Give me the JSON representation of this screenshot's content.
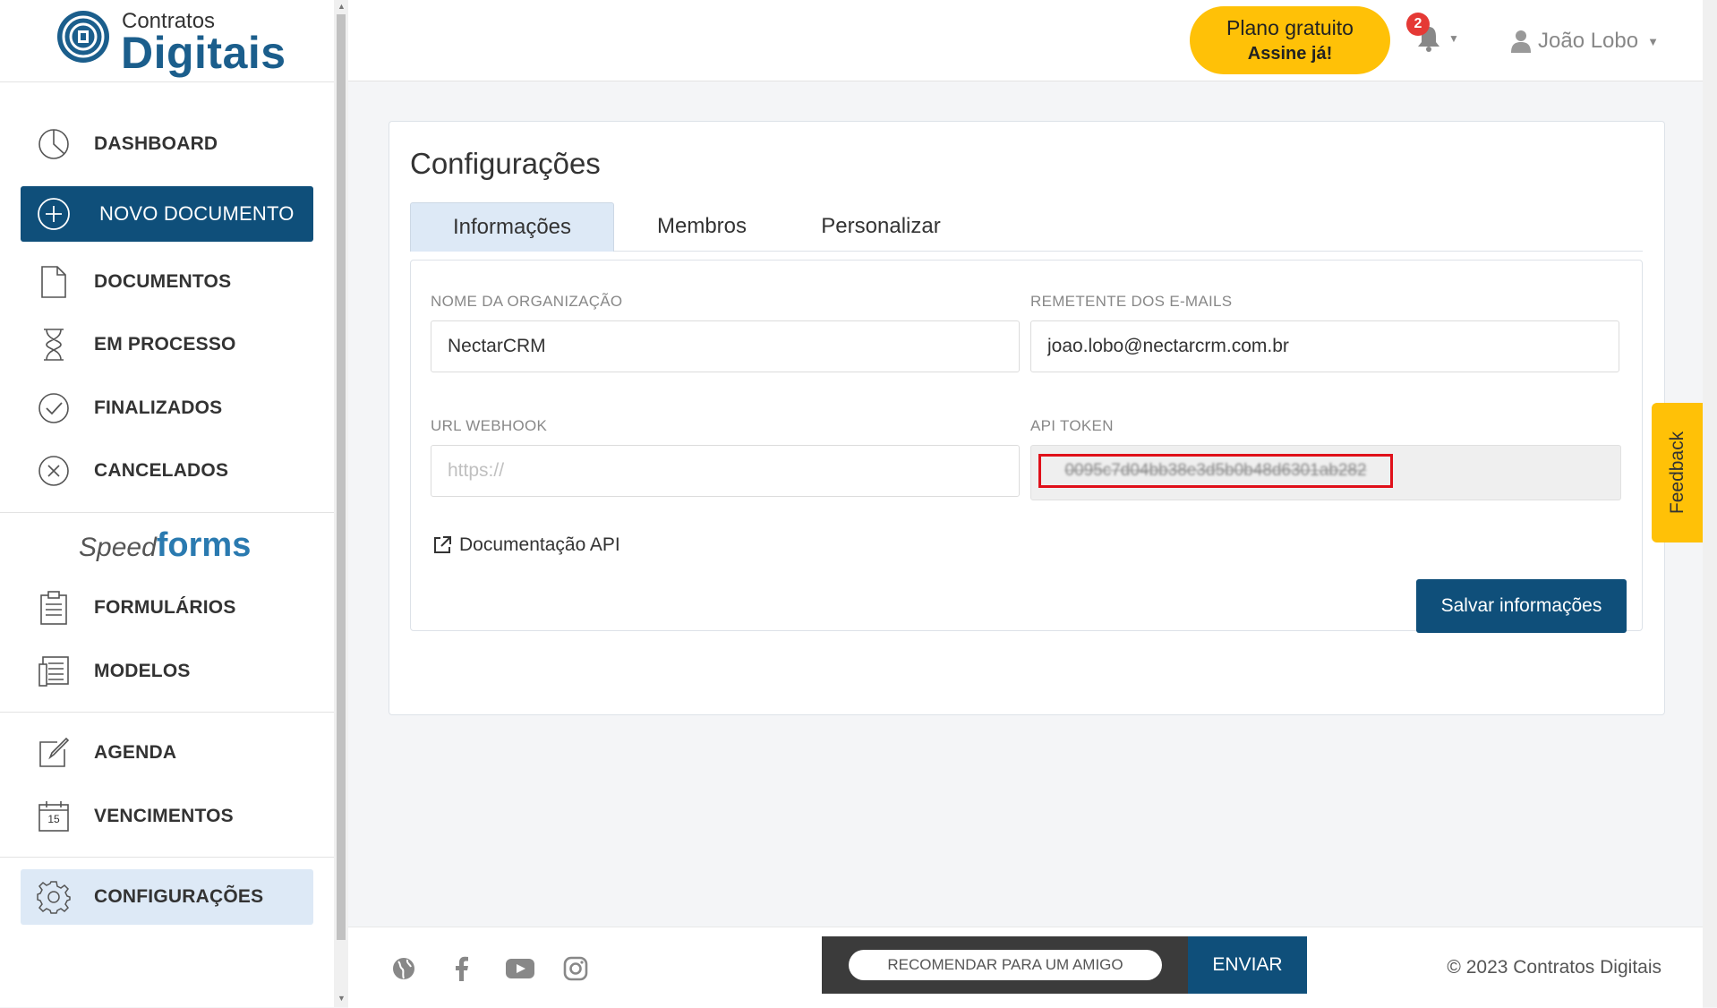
{
  "logo": {
    "small": "Contratos",
    "big": "Digitais"
  },
  "sidebar": {
    "items": [
      {
        "label": "DASHBOARD",
        "icon": "pie-chart-icon"
      },
      {
        "label": "NOVO DOCUMENTO",
        "icon": "plus-circle-icon"
      },
      {
        "label": "DOCUMENTOS",
        "icon": "document-icon"
      },
      {
        "label": "EM PROCESSO",
        "icon": "hourglass-icon"
      },
      {
        "label": "FINALIZADOS",
        "icon": "check-circle-icon"
      },
      {
        "label": "CANCELADOS",
        "icon": "x-circle-icon"
      },
      {
        "label": "FORMULÁRIOS",
        "icon": "clipboard-icon"
      },
      {
        "label": "MODELOS",
        "icon": "templates-icon"
      },
      {
        "label": "AGENDA",
        "icon": "edit-icon"
      },
      {
        "label": "VENCIMENTOS",
        "icon": "calendar-icon"
      },
      {
        "label": "CONFIGURAÇÕES",
        "icon": "gear-icon"
      }
    ],
    "speedforms": {
      "speed": "Speed",
      "forms": "forms"
    },
    "calendar_day": "15"
  },
  "header": {
    "plan": {
      "line1": "Plano gratuito",
      "line2": "Assine já!"
    },
    "notifications_count": "2",
    "user_name": "João Lobo"
  },
  "main": {
    "title": "Configurações",
    "tabs": [
      {
        "label": "Informações",
        "active": true
      },
      {
        "label": "Membros",
        "active": false
      },
      {
        "label": "Personalizar",
        "active": false
      }
    ],
    "form": {
      "org_label": "NOME DA ORGANIZAÇÃO",
      "org_value": "NectarCRM",
      "sender_label": "REMETENTE DOS E-MAILS",
      "sender_value": "joao.lobo@nectarcrm.com.br",
      "webhook_label": "URL WEBHOOK",
      "webhook_placeholder": "https://",
      "token_label": "API TOKEN",
      "token_value": "0095c7d04bb38e3d5b0b48d6301ab282"
    },
    "doc_link": "Documentação API",
    "save_label": "Salvar informações"
  },
  "footer": {
    "social": [
      "globe-icon",
      "facebook-icon",
      "youtube-icon",
      "instagram-icon"
    ],
    "recommend_placeholder": "RECOMENDAR PARA UM AMIGO",
    "send_label": "ENVIAR",
    "copyright": "© 2023 Contratos Digitais"
  },
  "feedback_label": "Feedback",
  "colors": {
    "primary": "#0f4f7a",
    "accent": "#ffc107",
    "active_bg": "#dde9f6",
    "highlight": "#e0101a"
  }
}
